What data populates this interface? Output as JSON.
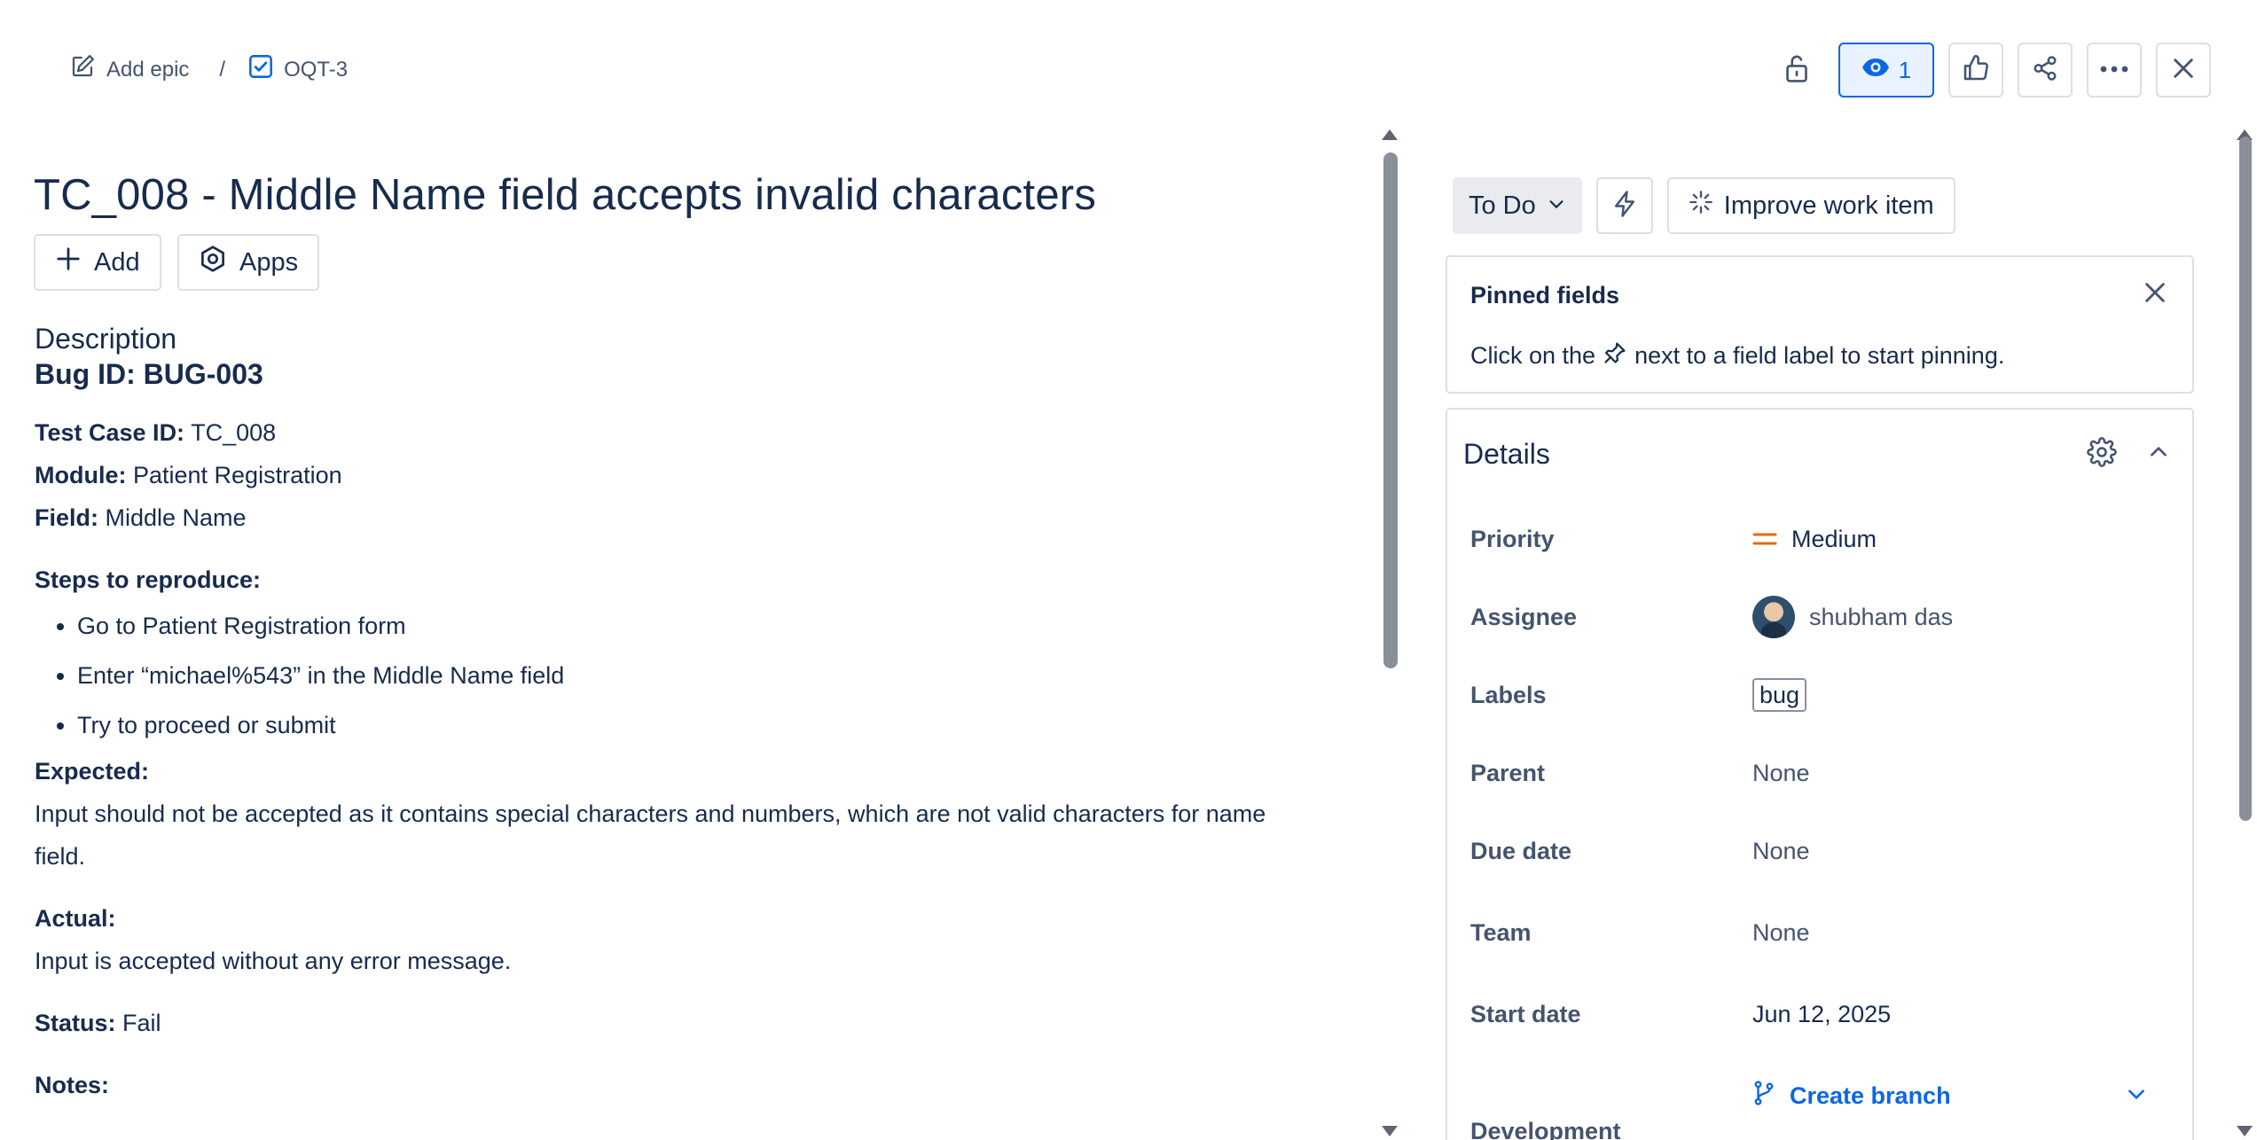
{
  "breadcrumb": {
    "add_epic": "Add epic",
    "separator": "/",
    "issue_key": "OQT-3"
  },
  "top_actions": {
    "watch_count": "1"
  },
  "issue": {
    "title": "TC_008 - Middle Name field accepts invalid characters",
    "add_label": "Add",
    "apps_label": "Apps"
  },
  "description": {
    "label": "Description",
    "bug_id": "Bug ID: BUG-003",
    "test_case_label": "Test Case ID:",
    "test_case_value": " TC_008",
    "module_label": "Module:",
    "module_value": " Patient Registration",
    "field_label": "Field:",
    "field_value": " Middle Name",
    "steps_label": "Steps to reproduce:",
    "steps": [
      "Go to Patient Registration form",
      "Enter “michael%543” in the Middle Name field",
      "Try to proceed or submit"
    ],
    "expected_label": "Expected:",
    "expected_value": "Input should not be accepted as it contains special characters and numbers, which are not valid characters for name field.",
    "actual_label": "Actual:",
    "actual_value": "Input is accepted without any error message.",
    "status_label": "Status:",
    "status_value": " Fail",
    "notes_label": "Notes:"
  },
  "sidebar": {
    "status": "To Do",
    "improve_label": "Improve work item",
    "pinned": {
      "title": "Pinned fields",
      "text_before": "Click on the",
      "text_after": "next to a field label to start pinning."
    },
    "details": {
      "title": "Details",
      "fields": [
        {
          "label": "Priority",
          "value": "Medium"
        },
        {
          "label": "Assignee",
          "value": "shubham das"
        },
        {
          "label": "Labels",
          "value": "bug"
        },
        {
          "label": "Parent",
          "value": "None"
        },
        {
          "label": "Due date",
          "value": "None"
        },
        {
          "label": "Team",
          "value": "None"
        },
        {
          "label": "Start date",
          "value": "Jun 12, 2025"
        },
        {
          "label": "Development",
          "value": "Create branch"
        }
      ]
    }
  },
  "colors": {
    "accent": "#0c66e4",
    "priority_medium": "#e56910",
    "text": "#172b4d",
    "subtle_text": "#44546f",
    "border": "#dcdfe4"
  }
}
